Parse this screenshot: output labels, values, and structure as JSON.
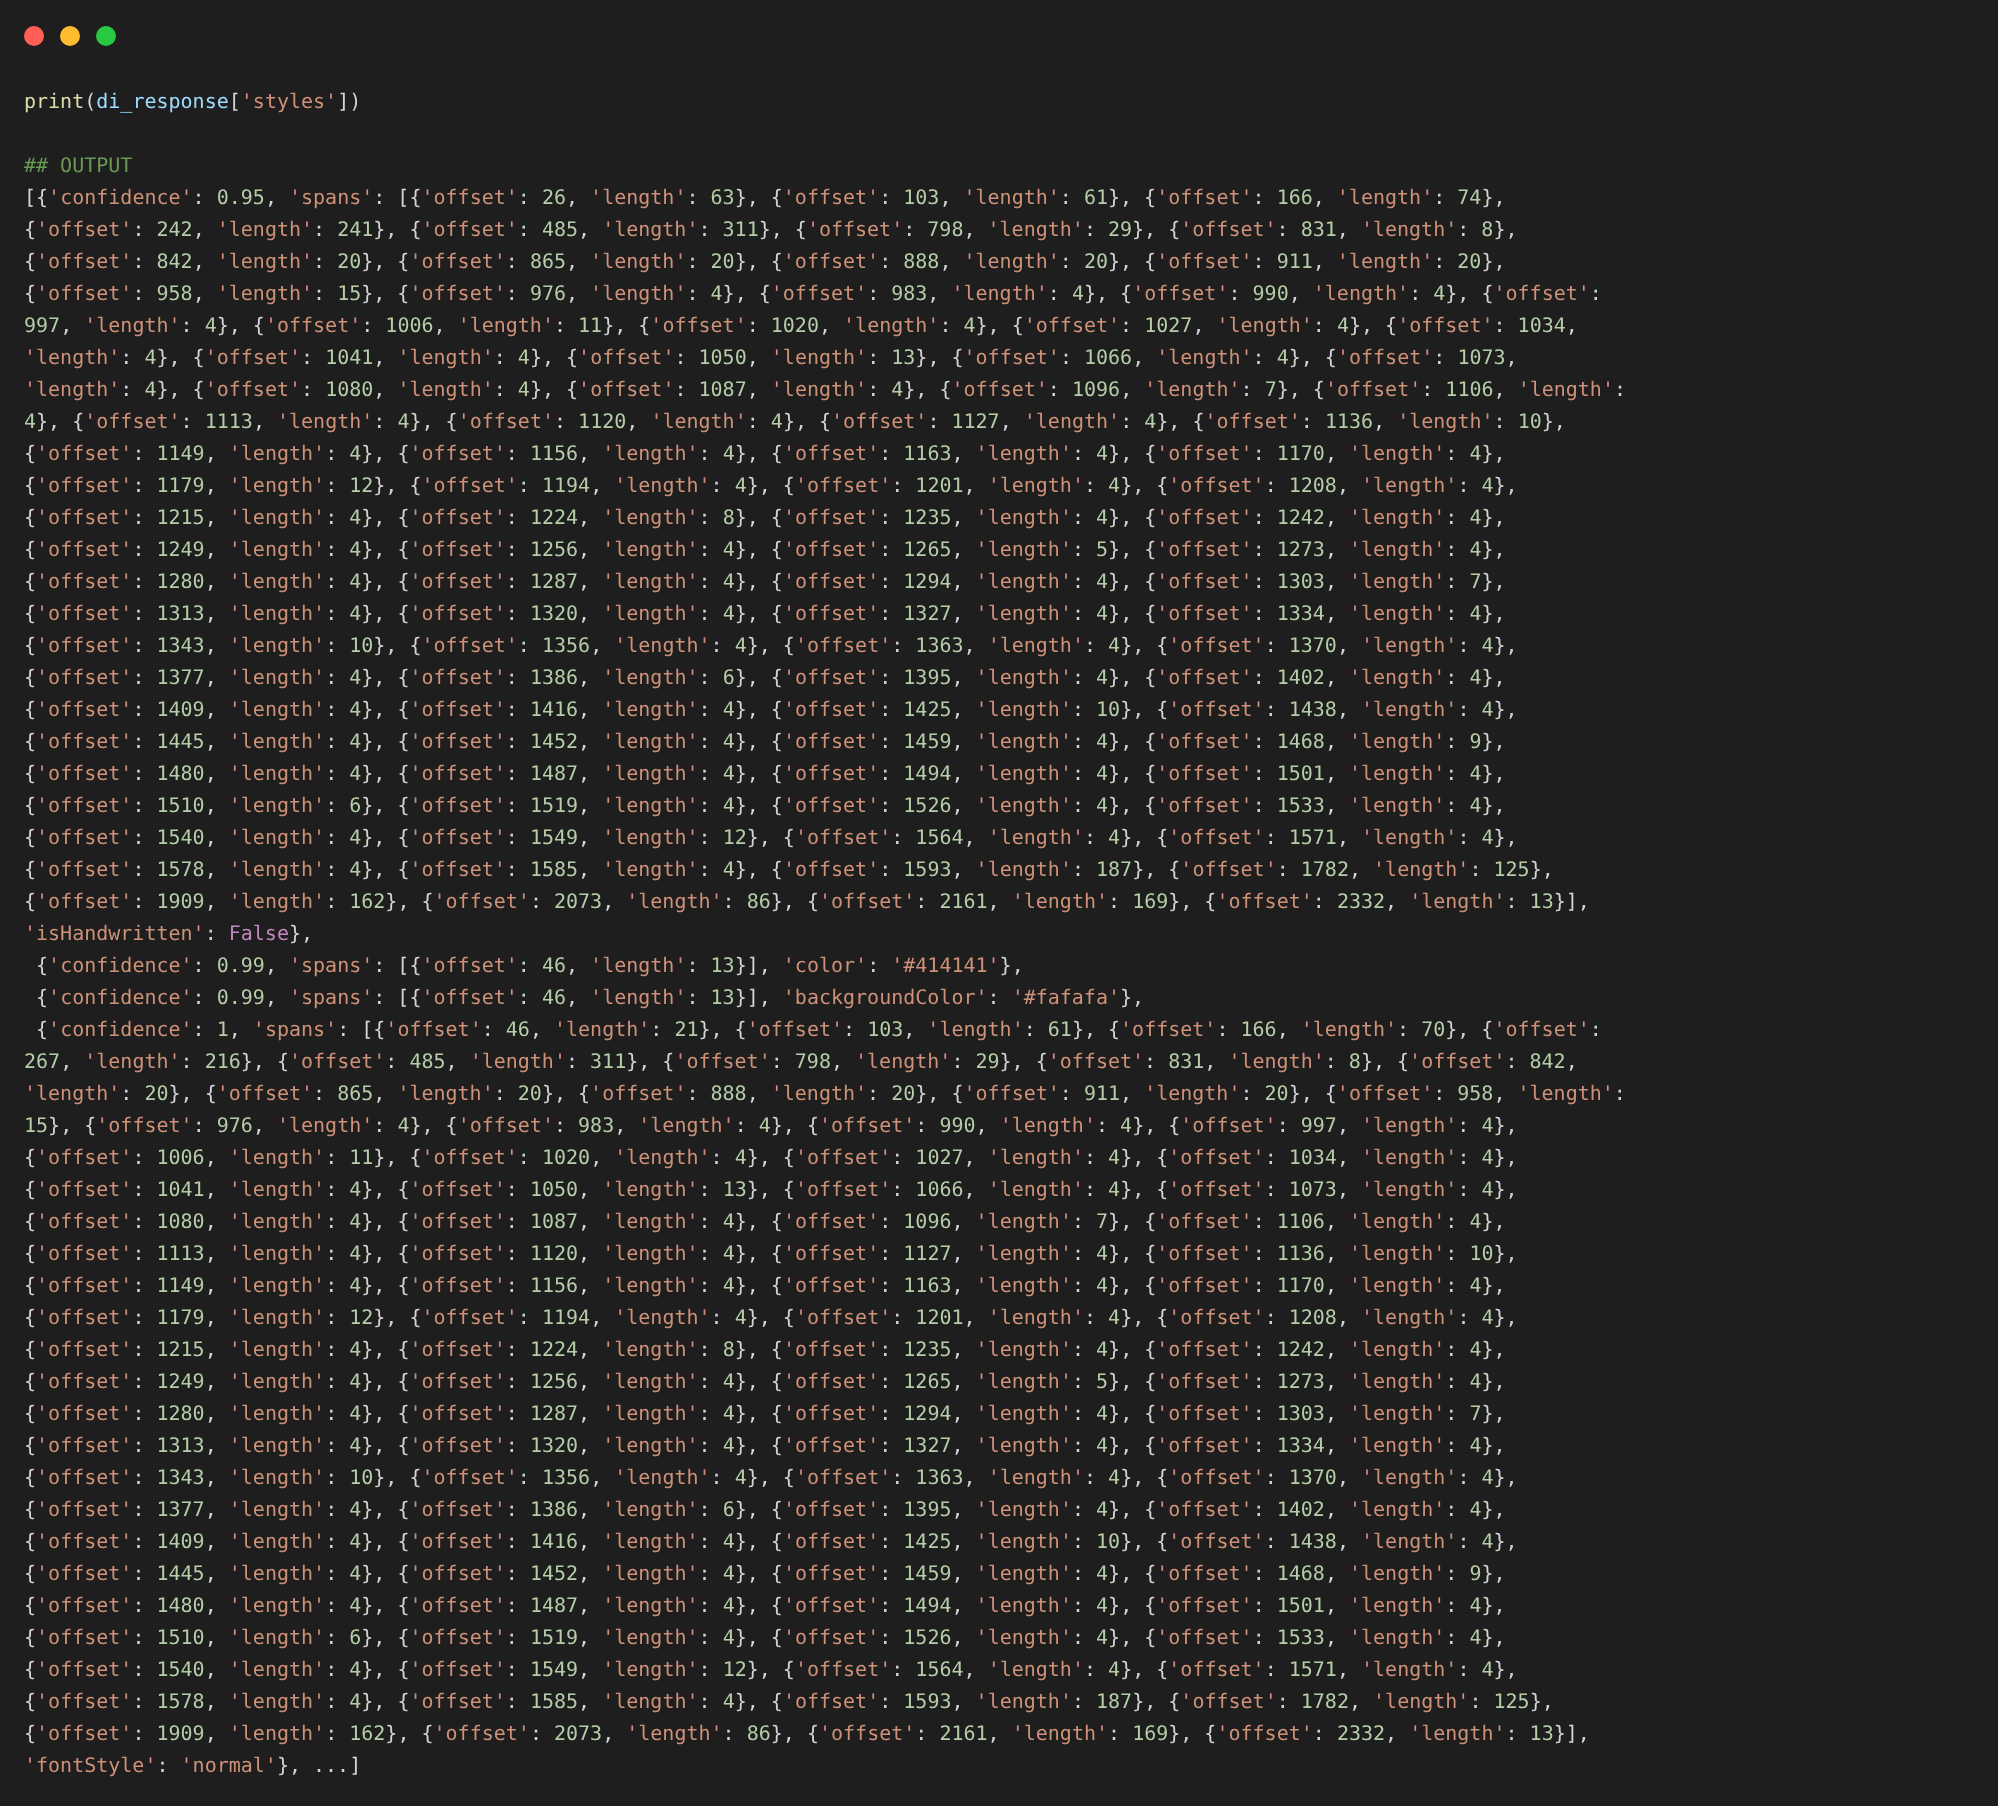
{
  "window": {
    "controls": [
      {
        "kind": "close"
      },
      {
        "kind": "minimize"
      },
      {
        "kind": "zoom"
      }
    ]
  },
  "input": "print(di_response['styles'])",
  "output_heading": "## OUTPUT",
  "output_lines": [
    "[{'confidence': 0.95, 'spans': [{'offset': 26, 'length': 63}, {'offset': 103, 'length': 61}, {'offset': 166, 'length': 74},",
    "{'offset': 242, 'length': 241}, {'offset': 485, 'length': 311}, {'offset': 798, 'length': 29}, {'offset': 831, 'length': 8},",
    "{'offset': 842, 'length': 20}, {'offset': 865, 'length': 20}, {'offset': 888, 'length': 20}, {'offset': 911, 'length': 20},",
    "{'offset': 958, 'length': 15}, {'offset': 976, 'length': 4}, {'offset': 983, 'length': 4}, {'offset': 990, 'length': 4}, {'offset':",
    "997, 'length': 4}, {'offset': 1006, 'length': 11}, {'offset': 1020, 'length': 4}, {'offset': 1027, 'length': 4}, {'offset': 1034,",
    "'length': 4}, {'offset': 1041, 'length': 4}, {'offset': 1050, 'length': 13}, {'offset': 1066, 'length': 4}, {'offset': 1073,",
    "'length': 4}, {'offset': 1080, 'length': 4}, {'offset': 1087, 'length': 4}, {'offset': 1096, 'length': 7}, {'offset': 1106, 'length':",
    "4}, {'offset': 1113, 'length': 4}, {'offset': 1120, 'length': 4}, {'offset': 1127, 'length': 4}, {'offset': 1136, 'length': 10},",
    "{'offset': 1149, 'length': 4}, {'offset': 1156, 'length': 4}, {'offset': 1163, 'length': 4}, {'offset': 1170, 'length': 4},",
    "{'offset': 1179, 'length': 12}, {'offset': 1194, 'length': 4}, {'offset': 1201, 'length': 4}, {'offset': 1208, 'length': 4},",
    "{'offset': 1215, 'length': 4}, {'offset': 1224, 'length': 8}, {'offset': 1235, 'length': 4}, {'offset': 1242, 'length': 4},",
    "{'offset': 1249, 'length': 4}, {'offset': 1256, 'length': 4}, {'offset': 1265, 'length': 5}, {'offset': 1273, 'length': 4},",
    "{'offset': 1280, 'length': 4}, {'offset': 1287, 'length': 4}, {'offset': 1294, 'length': 4}, {'offset': 1303, 'length': 7},",
    "{'offset': 1313, 'length': 4}, {'offset': 1320, 'length': 4}, {'offset': 1327, 'length': 4}, {'offset': 1334, 'length': 4},",
    "{'offset': 1343, 'length': 10}, {'offset': 1356, 'length': 4}, {'offset': 1363, 'length': 4}, {'offset': 1370, 'length': 4},",
    "{'offset': 1377, 'length': 4}, {'offset': 1386, 'length': 6}, {'offset': 1395, 'length': 4}, {'offset': 1402, 'length': 4},",
    "{'offset': 1409, 'length': 4}, {'offset': 1416, 'length': 4}, {'offset': 1425, 'length': 10}, {'offset': 1438, 'length': 4},",
    "{'offset': 1445, 'length': 4}, {'offset': 1452, 'length': 4}, {'offset': 1459, 'length': 4}, {'offset': 1468, 'length': 9},",
    "{'offset': 1480, 'length': 4}, {'offset': 1487, 'length': 4}, {'offset': 1494, 'length': 4}, {'offset': 1501, 'length': 4},",
    "{'offset': 1510, 'length': 6}, {'offset': 1519, 'length': 4}, {'offset': 1526, 'length': 4}, {'offset': 1533, 'length': 4},",
    "{'offset': 1540, 'length': 4}, {'offset': 1549, 'length': 12}, {'offset': 1564, 'length': 4}, {'offset': 1571, 'length': 4},",
    "{'offset': 1578, 'length': 4}, {'offset': 1585, 'length': 4}, {'offset': 1593, 'length': 187}, {'offset': 1782, 'length': 125},",
    "{'offset': 1909, 'length': 162}, {'offset': 2073, 'length': 86}, {'offset': 2161, 'length': 169}, {'offset': 2332, 'length': 13}],",
    "'isHandwritten': False},",
    " {'confidence': 0.99, 'spans': [{'offset': 46, 'length': 13}], 'color': '#414141'},",
    " {'confidence': 0.99, 'spans': [{'offset': 46, 'length': 13}], 'backgroundColor': '#fafafa'},",
    " {'confidence': 1, 'spans': [{'offset': 46, 'length': 21}, {'offset': 103, 'length': 61}, {'offset': 166, 'length': 70}, {'offset':",
    "267, 'length': 216}, {'offset': 485, 'length': 311}, {'offset': 798, 'length': 29}, {'offset': 831, 'length': 8}, {'offset': 842,",
    "'length': 20}, {'offset': 865, 'length': 20}, {'offset': 888, 'length': 20}, {'offset': 911, 'length': 20}, {'offset': 958, 'length':",
    "15}, {'offset': 976, 'length': 4}, {'offset': 983, 'length': 4}, {'offset': 990, 'length': 4}, {'offset': 997, 'length': 4},",
    "{'offset': 1006, 'length': 11}, {'offset': 1020, 'length': 4}, {'offset': 1027, 'length': 4}, {'offset': 1034, 'length': 4},",
    "{'offset': 1041, 'length': 4}, {'offset': 1050, 'length': 13}, {'offset': 1066, 'length': 4}, {'offset': 1073, 'length': 4},",
    "{'offset': 1080, 'length': 4}, {'offset': 1087, 'length': 4}, {'offset': 1096, 'length': 7}, {'offset': 1106, 'length': 4},",
    "{'offset': 1113, 'length': 4}, {'offset': 1120, 'length': 4}, {'offset': 1127, 'length': 4}, {'offset': 1136, 'length': 10},",
    "{'offset': 1149, 'length': 4}, {'offset': 1156, 'length': 4}, {'offset': 1163, 'length': 4}, {'offset': 1170, 'length': 4},",
    "{'offset': 1179, 'length': 12}, {'offset': 1194, 'length': 4}, {'offset': 1201, 'length': 4}, {'offset': 1208, 'length': 4},",
    "{'offset': 1215, 'length': 4}, {'offset': 1224, 'length': 8}, {'offset': 1235, 'length': 4}, {'offset': 1242, 'length': 4},",
    "{'offset': 1249, 'length': 4}, {'offset': 1256, 'length': 4}, {'offset': 1265, 'length': 5}, {'offset': 1273, 'length': 4},",
    "{'offset': 1280, 'length': 4}, {'offset': 1287, 'length': 4}, {'offset': 1294, 'length': 4}, {'offset': 1303, 'length': 7},",
    "{'offset': 1313, 'length': 4}, {'offset': 1320, 'length': 4}, {'offset': 1327, 'length': 4}, {'offset': 1334, 'length': 4},",
    "{'offset': 1343, 'length': 10}, {'offset': 1356, 'length': 4}, {'offset': 1363, 'length': 4}, {'offset': 1370, 'length': 4},",
    "{'offset': 1377, 'length': 4}, {'offset': 1386, 'length': 6}, {'offset': 1395, 'length': 4}, {'offset': 1402, 'length': 4},",
    "{'offset': 1409, 'length': 4}, {'offset': 1416, 'length': 4}, {'offset': 1425, 'length': 10}, {'offset': 1438, 'length': 4},",
    "{'offset': 1445, 'length': 4}, {'offset': 1452, 'length': 4}, {'offset': 1459, 'length': 4}, {'offset': 1468, 'length': 9},",
    "{'offset': 1480, 'length': 4}, {'offset': 1487, 'length': 4}, {'offset': 1494, 'length': 4}, {'offset': 1501, 'length': 4},",
    "{'offset': 1510, 'length': 6}, {'offset': 1519, 'length': 4}, {'offset': 1526, 'length': 4}, {'offset': 1533, 'length': 4},",
    "{'offset': 1540, 'length': 4}, {'offset': 1549, 'length': 12}, {'offset': 1564, 'length': 4}, {'offset': 1571, 'length': 4},",
    "{'offset': 1578, 'length': 4}, {'offset': 1585, 'length': 4}, {'offset': 1593, 'length': 187}, {'offset': 1782, 'length': 125},",
    "{'offset': 1909, 'length': 162}, {'offset': 2073, 'length': 86}, {'offset': 2161, 'length': 169}, {'offset': 2332, 'length': 13}],",
    "'fontStyle': 'normal'}, ...]"
  ]
}
